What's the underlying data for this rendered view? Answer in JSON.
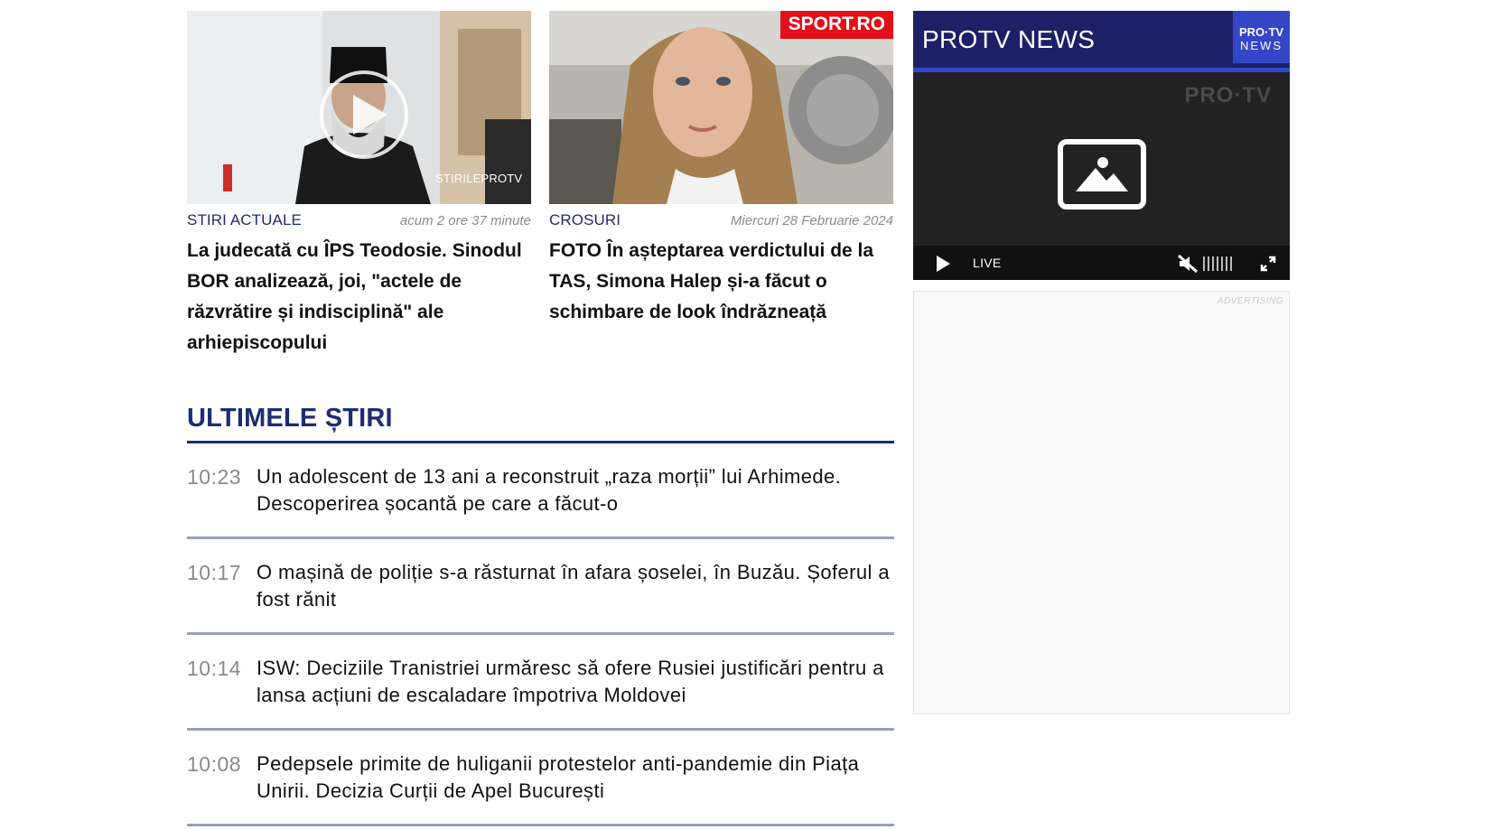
{
  "cards": [
    {
      "category": "STIRI ACTUALE",
      "time": "acum 2 ore 37 minute",
      "headline": "La judecată cu ÎPS Teodosie. Sinodul BOR analizează, joi, \"actele de răzvrătire și indisciplină\" ale arhiepiscopului",
      "watermark": "STIRILEPROTV",
      "has_play": true
    },
    {
      "category": "CROSURI",
      "time": "Miercuri 28 Februarie 2024",
      "headline": "FOTO În așteptarea verdictului de la TAS, Simona Halep și-a făcut o schimbare de look îndrăzneață",
      "badge": "SPORT.RO"
    }
  ],
  "latest": {
    "title": "ULTIMELE ȘTIRI",
    "items": [
      {
        "time": "10:23",
        "text": "Un adolescent de 13 ani a reconstruit „raza morții” lui Arhimede. Descoperirea șocantă pe care a făcut-o"
      },
      {
        "time": "10:17",
        "text": "O mașină de poliție s-a răsturnat în afara șoselei, în Buzău. Șoferul a fost rănit"
      },
      {
        "time": "10:14",
        "text": "ISW: Deciziile Tranistriei urmăresc să ofere Rusiei justificări pentru a lansa acțiuni de escaladare împotriva Moldovei"
      },
      {
        "time": "10:08",
        "text": "Pedepsele primite de huliganii protestelor anti-pandemie din Piața Unirii. Decizia Curții de Apel București"
      }
    ]
  },
  "player": {
    "title": "PROTV NEWS",
    "logo_line1": "PRO·TV",
    "logo_line2": "NEWS",
    "watermark": "PRO·TV",
    "live_label": "LIVE"
  },
  "ad": {
    "label": "ADVERTISING"
  },
  "colors": {
    "brand_navy": "#1c2c73",
    "player_header": "#1d2066",
    "player_accent": "#3346c7",
    "sport_red": "#e3101b"
  }
}
